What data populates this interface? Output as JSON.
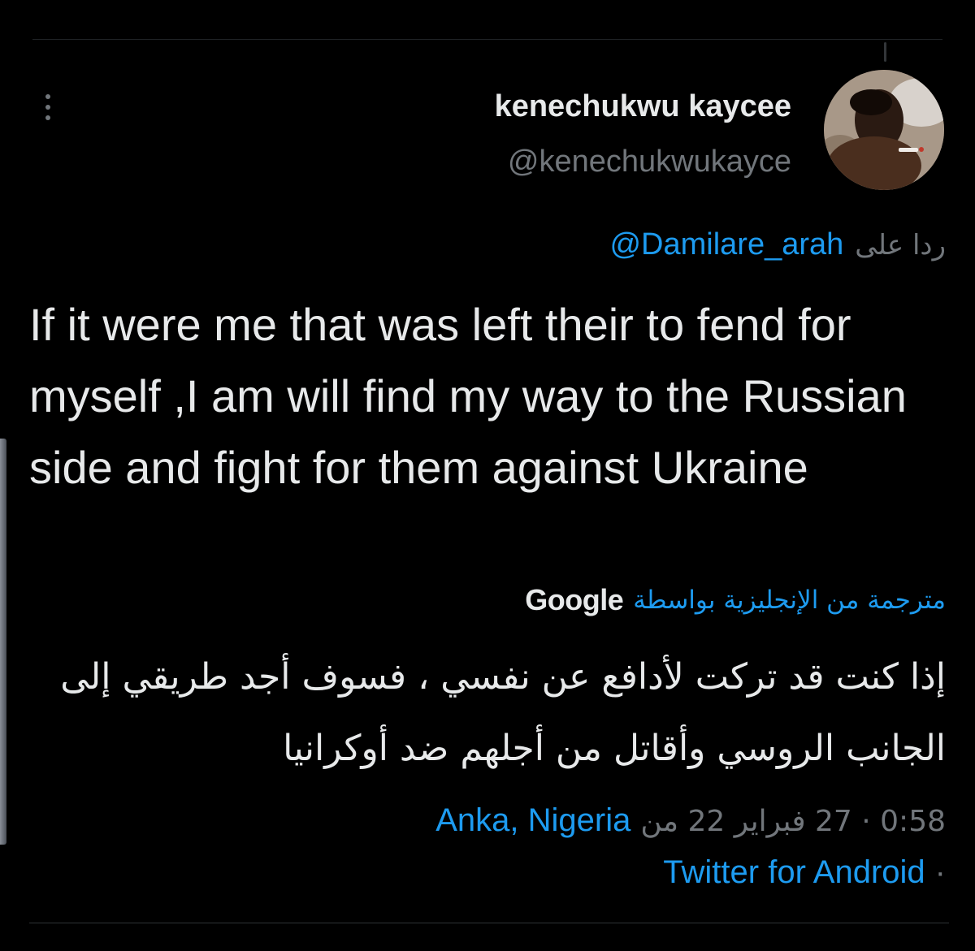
{
  "tweet": {
    "author": {
      "display_name": "kenechukwu kaycee",
      "handle": "@kenechukwukayce"
    },
    "reply": {
      "prefix": "ردا على",
      "mention": "@Damilare_arah"
    },
    "text": "If it were me that was left their to fend for myself ,I am will find my way to the Russian side and fight for them against Ukraine",
    "translation": {
      "label": "مترجمة من الإنجليزية بواسطة",
      "provider": "Google",
      "text": "إذا كنت قد تركت لأدافع عن نفسي ، فسوف أجد طريقي إلى الجانب الروسي وأقاتل من أجلهم ضد أوكرانيا"
    },
    "meta": {
      "time_date": "0:58 · 27 فبراير 22 من",
      "location": "Anka, Nigeria",
      "separator": "·",
      "source": "Twitter for Android"
    }
  },
  "icons": {
    "more": "more-vertical-icon",
    "avatar": "avatar"
  },
  "colors": {
    "background": "#000000",
    "primary_text": "#e7e9ea",
    "secondary_text": "#71767b",
    "link": "#1d9bf0",
    "divider": "#2f3336"
  }
}
